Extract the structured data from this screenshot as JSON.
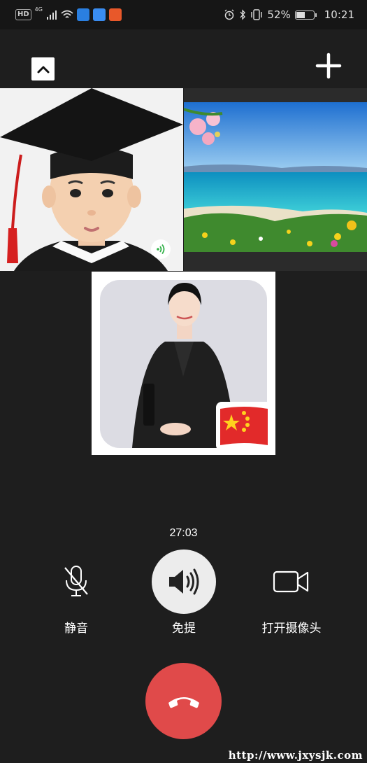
{
  "status_bar": {
    "left_badge": "HD",
    "network": "4G",
    "battery_percent": "52%",
    "battery_level": 0.52,
    "time": "10:21",
    "icons": [
      "signal-icon",
      "wifi-icon",
      "app-icon-1",
      "app-icon-2",
      "app-icon-3",
      "alarm-icon",
      "bluetooth-icon",
      "vibrate-icon",
      "battery-icon"
    ]
  },
  "top": {
    "collapse_icon": "chevron-up-icon",
    "add_icon": "plus-icon"
  },
  "participants": [
    {
      "id": "boy",
      "speaking": true
    },
    {
      "id": "seascape"
    },
    {
      "id": "woman",
      "flag": "china-flag"
    }
  ],
  "call": {
    "timer": "27:03"
  },
  "controls": {
    "mute_label": "静音",
    "speaker_label": "免提",
    "camera_label": "打开摄像头"
  },
  "hangup": {
    "icon": "phone-hangup-icon",
    "color": "#e04a4a"
  },
  "watermark": "http://www.jxysjk.com"
}
